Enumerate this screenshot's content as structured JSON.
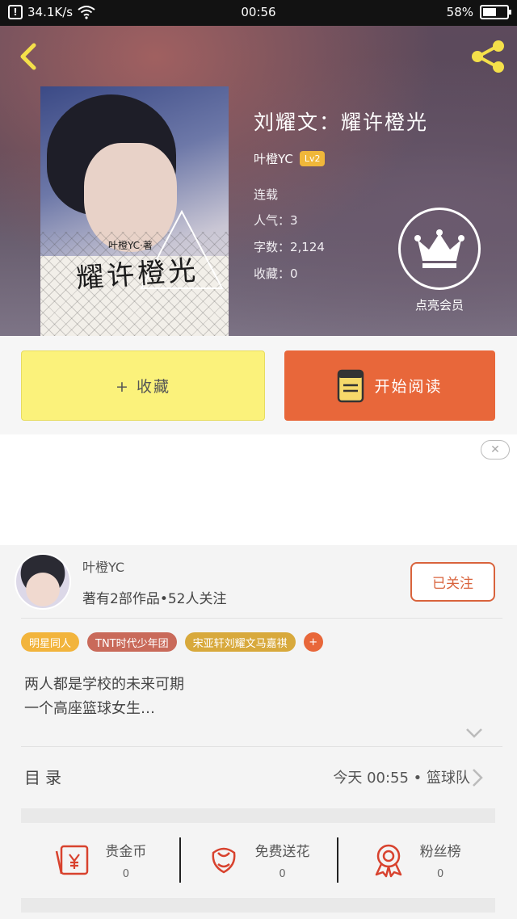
{
  "status_bar": {
    "speed": "34.1K/s",
    "time": "00:56",
    "battery": "58%",
    "battery_level": 0.58
  },
  "book": {
    "title": "刘耀文：耀许橙光",
    "cover_byline": "叶橙YC·著",
    "cover_title": "耀许橙光",
    "author": "叶橙YC",
    "level": "Lv2",
    "status": "连载",
    "popularity": "人气：3",
    "word_count": "字数：2,124",
    "favorites": "收藏：0"
  },
  "vip": {
    "label": "点亮会员"
  },
  "actions": {
    "collect": "+ 收藏",
    "read": "开始阅读"
  },
  "ad": {
    "close_icon": "close-icon"
  },
  "author_card": {
    "name": "叶橙YC",
    "stats": "著有2部作品•52人关注",
    "follow": "已关注"
  },
  "tags": [
    {
      "label": "明星同人",
      "color": "#f2b43c"
    },
    {
      "label": "TNT时代少年团",
      "color": "#c96a5a"
    },
    {
      "label": "宋亚轩刘耀文马嘉祺",
      "color": "#d8a93c"
    }
  ],
  "tag_more": "+",
  "description": {
    "line1": "两人都是学校的未来可期",
    "line2": "一个高座篮球女生…"
  },
  "catalog": {
    "label": "目录",
    "latest": "今天 00:55 • 篮球队"
  },
  "stats": [
    {
      "label": "贵金币",
      "value": "0",
      "icon": "red-envelope-icon"
    },
    {
      "label": "免费送花",
      "value": "0",
      "icon": "flower-icon"
    },
    {
      "label": "粉丝榜",
      "value": "0",
      "icon": "medal-icon"
    }
  ],
  "colors": {
    "accent": "#e8673a",
    "collect_yellow": "#fbf27b",
    "header_bg": "#5d4a5c"
  }
}
